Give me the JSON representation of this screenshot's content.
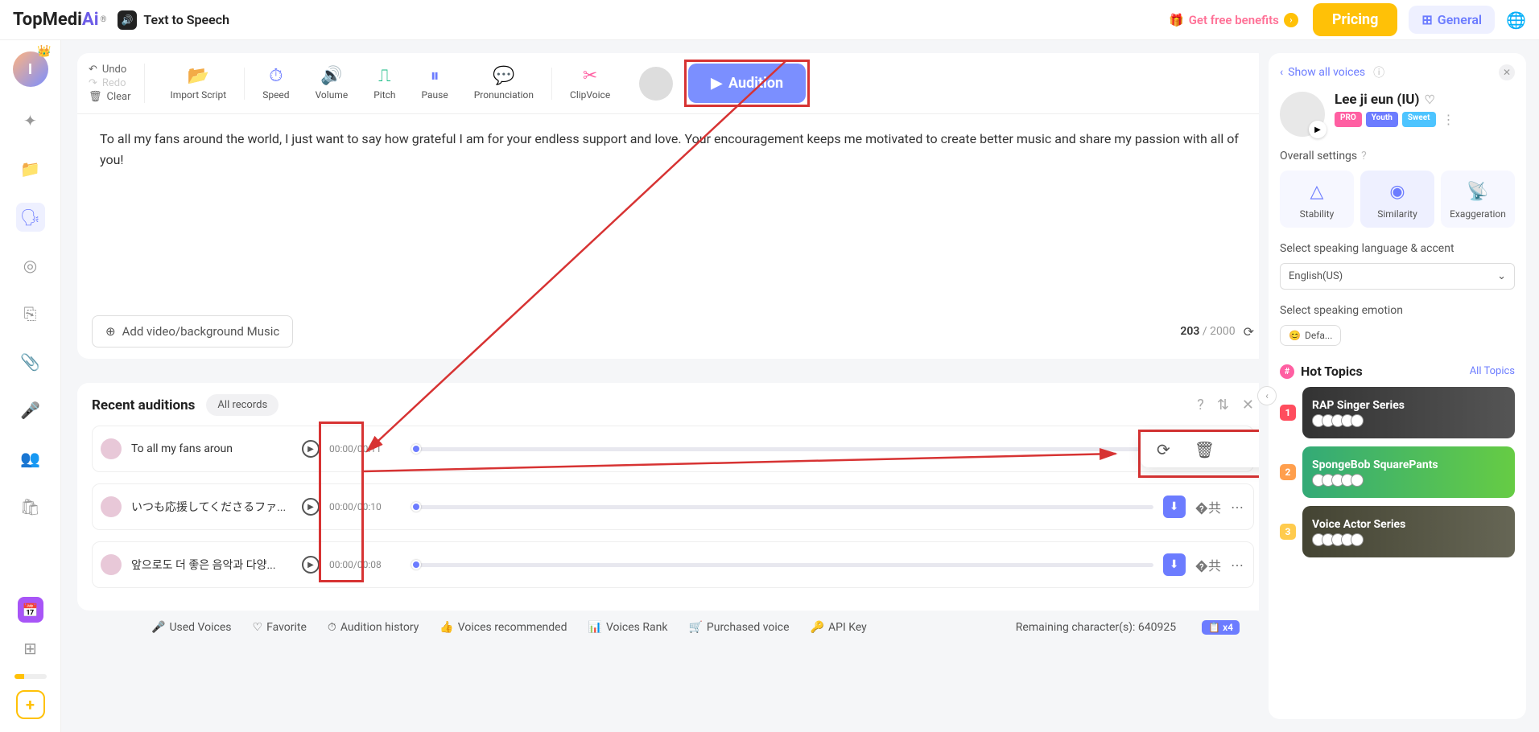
{
  "header": {
    "logo_main": "TopMedi",
    "logo_ai": "Ai",
    "tts_label": "Text to Speech",
    "free_benefits": "Get free benefits",
    "pricing": "Pricing",
    "general": "General"
  },
  "sidebar": {
    "avatar_initial": "I"
  },
  "toolbar": {
    "undo": "Undo",
    "redo": "Redo",
    "clear": "Clear",
    "import": "Import Script",
    "speed": "Speed",
    "volume": "Volume",
    "pitch": "Pitch",
    "pause": "Pause",
    "pronunciation": "Pronunciation",
    "clipvoice": "ClipVoice",
    "audition": "Audition"
  },
  "editor": {
    "text": "To all my fans around the world, I just want to say how grateful I am for your endless support and love. Your encouragement keeps me motivated to create better music and share my passion with all of you!",
    "add_media": "Add video/background Music",
    "char_current": "203",
    "char_max": "/ 2000"
  },
  "recent": {
    "title": "Recent auditions",
    "all_records": "All records",
    "rows": [
      {
        "text": "To all my fans aroun",
        "time": "00:00/00:11"
      },
      {
        "text": "いつも応援してくださるファ...",
        "time": "00:00/00:10"
      },
      {
        "text": "앞으로도 더 좋은 음악과 다양...",
        "time": "00:00/00:08"
      }
    ]
  },
  "footer": {
    "used_voices": "Used Voices",
    "favorite": "Favorite",
    "audition_history": "Audition history",
    "voices_recommended": "Voices recommended",
    "voices_rank": "Voices Rank",
    "purchased_voice": "Purchased voice",
    "api_key": "API Key",
    "remaining": "Remaining character(s): 640925",
    "x4": "x4"
  },
  "right": {
    "show_all": "Show all voices",
    "voice_name": "Lee ji eun (IU)",
    "badge_pro": "PRO",
    "badge_youth": "Youth",
    "badge_sweet": "Sweet",
    "overall_settings": "Overall settings",
    "stability": "Stability",
    "similarity": "Similarity",
    "exaggeration": "Exaggeration",
    "lang_label": "Select speaking language & accent",
    "lang_value": "English(US)",
    "emotion_label": "Select speaking emotion",
    "emotion_value": "Defa...",
    "hot_topics": "Hot Topics",
    "all_topics": "All Topics",
    "topics": [
      {
        "name": "RAP Singer Series"
      },
      {
        "name": "SpongeBob SquarePants"
      },
      {
        "name": "Voice Actor Series"
      }
    ]
  }
}
